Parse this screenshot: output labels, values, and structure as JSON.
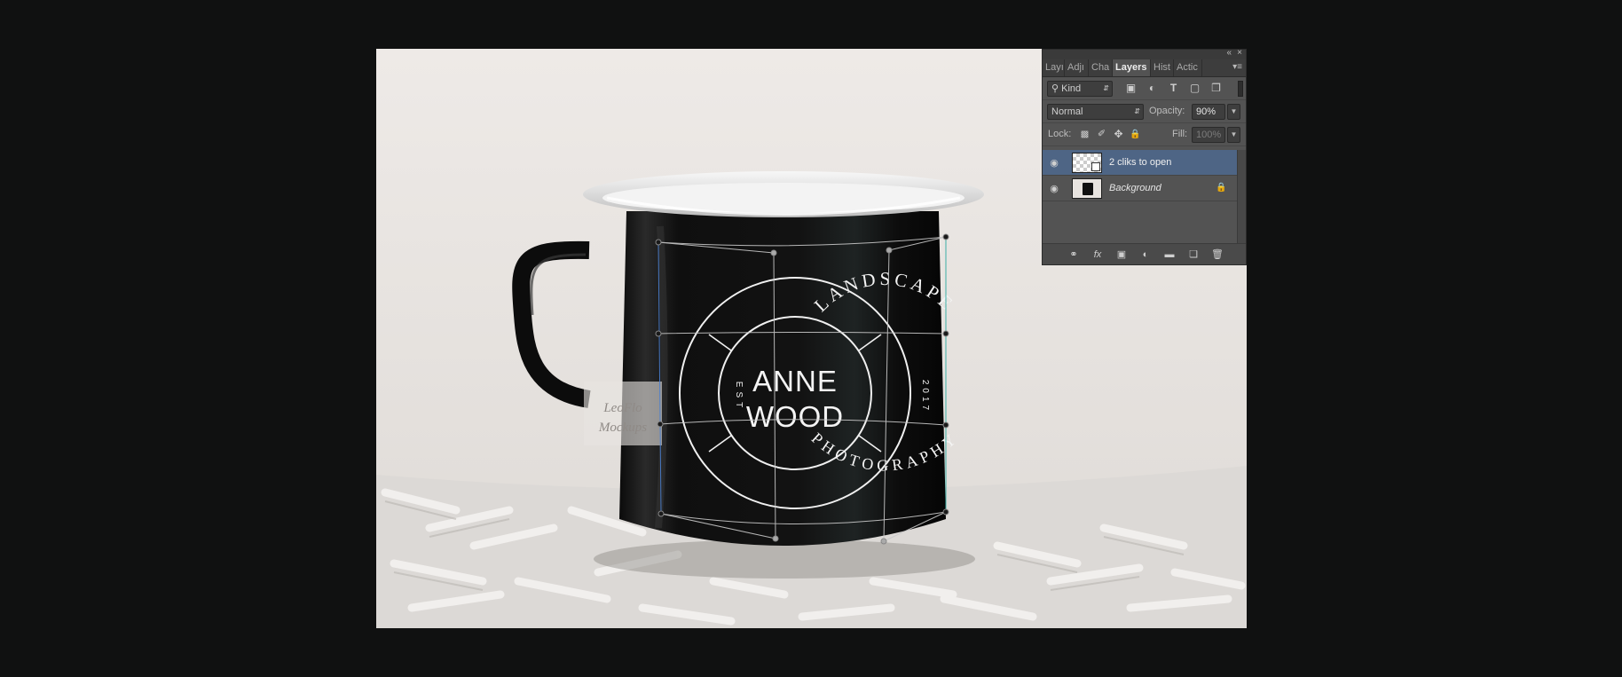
{
  "colors": {
    "app_background": "#101111",
    "panel_background": "#535353",
    "selected_layer": "#4e6585",
    "mug_body": "#101010",
    "logo_white": "#f4f4f4"
  },
  "canvas": {
    "logo": {
      "top_arc": "LANDSCAPE",
      "bottom_arc": "PHOTOGRAPHY",
      "name_line1": "ANNE",
      "name_line2": "WOOD",
      "left_side": "EST",
      "right_side": "2017"
    },
    "watermark_line1": "LeoFlo",
    "watermark_line2": "Mockups"
  },
  "layers_panel": {
    "collapse_icon": "double-chevron-left-icon",
    "close_icon": "close-icon",
    "tabs": [
      {
        "label": "Layers (truncated)",
        "text": "Layı",
        "active": false
      },
      {
        "label": "Adjustments",
        "text": "Adjı",
        "active": false
      },
      {
        "label": "Channels",
        "text": "Cha",
        "active": false
      },
      {
        "label": "Layers",
        "text": "Layers",
        "active": true
      },
      {
        "label": "History",
        "text": "Hist",
        "active": false
      },
      {
        "label": "Actions",
        "text": "Actic",
        "active": false
      }
    ],
    "filter": {
      "kind_label": "Kind",
      "icons": [
        "image-filter-icon",
        "adjustment-filter-icon",
        "type-filter-icon",
        "shape-filter-icon",
        "smart-object-filter-icon"
      ]
    },
    "blend_mode": "Normal",
    "opacity_label": "Opacity:",
    "opacity_value": "90%",
    "lock_label": "Lock:",
    "fill_label": "Fill:",
    "fill_value": "100%",
    "layers": [
      {
        "name": "2 cliks to open",
        "selected": true,
        "italic": false,
        "locked": false,
        "thumbnail": "smart-object"
      },
      {
        "name": "Background",
        "selected": false,
        "italic": true,
        "locked": true,
        "thumbnail": "photo"
      }
    ],
    "bottom_icons": [
      "link-layers-icon",
      "fx-icon",
      "add-mask-icon",
      "adjustment-layer-icon",
      "new-group-icon",
      "new-layer-icon",
      "trash-icon"
    ],
    "fx_text": "fx"
  }
}
